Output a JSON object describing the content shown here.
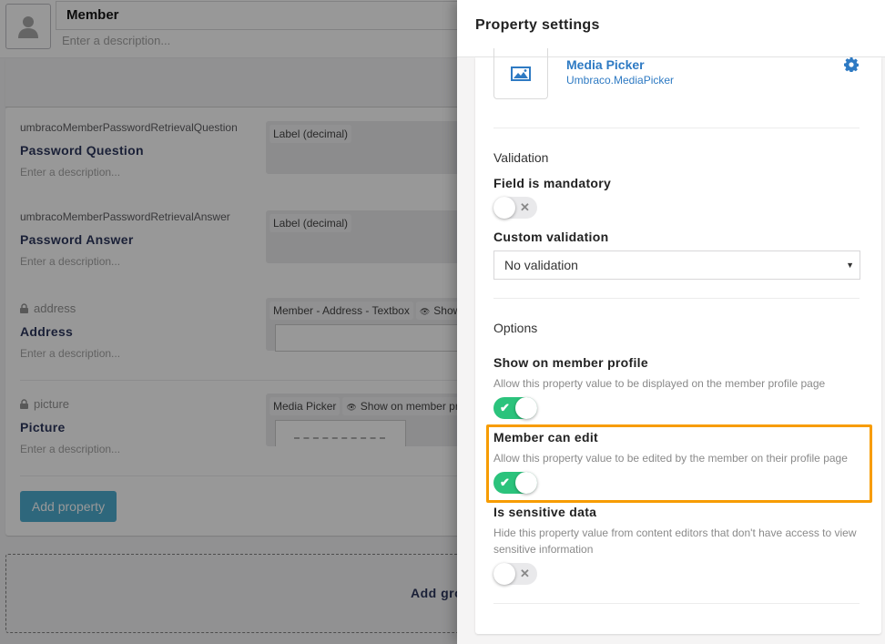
{
  "editor": {
    "name_value": "Member",
    "description_placeholder": "Enter a description...",
    "avatar_icon": "user-icon",
    "properties": [
      {
        "alias": "umbracoMemberPasswordRetrievalQuestion",
        "label": "Password Question",
        "description_placeholder": "Enter a description...",
        "locked": false,
        "tags": [
          "Label (decimal)"
        ]
      },
      {
        "alias": "umbracoMemberPasswordRetrievalAnswer",
        "label": "Password Answer",
        "description_placeholder": "Enter a description...",
        "locked": false,
        "tags": [
          "Label (decimal)"
        ]
      },
      {
        "alias": "address",
        "label": "Address",
        "description_placeholder": "Enter a description...",
        "locked": true,
        "tags": [
          "Member - Address - Textbox",
          "Show"
        ]
      },
      {
        "alias": "picture",
        "label": "Picture",
        "description_placeholder": "Enter a description...",
        "locked": true,
        "tags": [
          "Media Picker",
          "Show on member pr"
        ]
      }
    ],
    "add_property_label": "Add property",
    "add_group_label": "Add gro"
  },
  "panel": {
    "title": "Property settings",
    "property_editor": {
      "name": "Media Picker",
      "alias": "Umbraco.MediaPicker",
      "icon": "image-icon",
      "settings_icon": "gear-icon"
    },
    "validation": {
      "section_title": "Validation",
      "mandatory_label": "Field is mandatory",
      "mandatory_on": false,
      "custom_label": "Custom validation",
      "custom_selected": "No validation"
    },
    "options": {
      "section_title": "Options",
      "show_on_profile": {
        "label": "Show on member profile",
        "description": "Allow this property value to be displayed on the member profile page",
        "on": true
      },
      "member_can_edit": {
        "label": "Member can edit",
        "description": "Allow this property value to be edited by the member on their profile page",
        "on": true
      },
      "is_sensitive": {
        "label": "Is sensitive data",
        "description": "Hide this property value from content editors that don't have access to view sensitive information",
        "on": false
      }
    },
    "toggle_glyphs": {
      "on": "✔",
      "off": "✕"
    }
  },
  "colors": {
    "toggle_on": "#2bc37c",
    "link_blue": "#2e7ac3",
    "highlight": "#f79c00",
    "add_button": "#3fa7cd"
  }
}
